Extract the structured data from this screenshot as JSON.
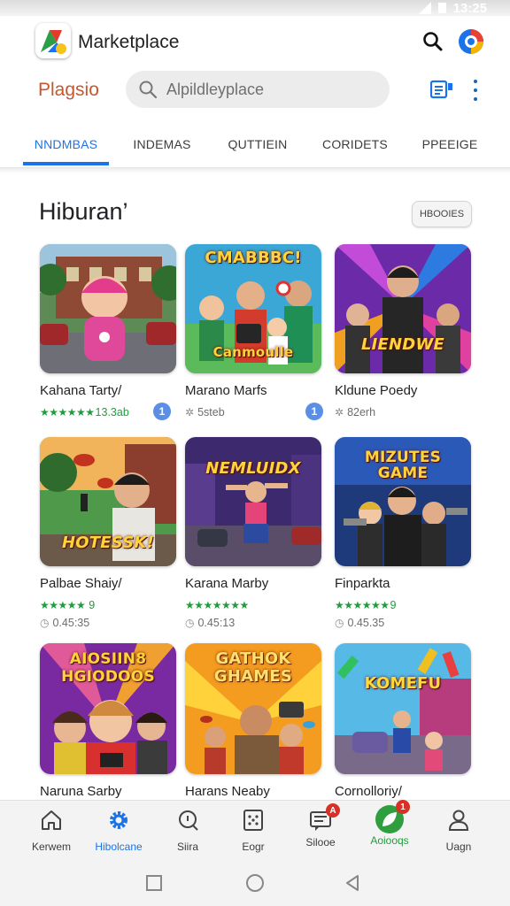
{
  "status_bar": {
    "time": "13:25"
  },
  "app_bar": {
    "title": "Marketplace",
    "icons": [
      "app-logo-icon",
      "search-icon",
      "account-icon"
    ]
  },
  "search": {
    "brand": "Plagsio",
    "placeholder": "Alpildleyplace"
  },
  "tabs": [
    {
      "label": "NNDMBAS",
      "active": true
    },
    {
      "label": "INDEMAS",
      "active": false
    },
    {
      "label": "QUTTIEIN",
      "active": false
    },
    {
      "label": "CORIDETS",
      "active": false
    },
    {
      "label": "PPEEIGE",
      "active": false
    }
  ],
  "section": {
    "title": "Hiburan’",
    "more_label": "HBOOIES"
  },
  "cards": [
    {
      "thumb_text": "",
      "name": "Kahana Tarty/",
      "stars": "★★★★★★",
      "rating": "13.3ab",
      "badge": "1",
      "size": ""
    },
    {
      "thumb_text": "CMABBBC!",
      "thumb_text2": "Canmoulle",
      "name": "Marano Marfs",
      "meta": "5steb",
      "badge": "1",
      "size": ""
    },
    {
      "thumb_text": "LIENDWE",
      "name": "Kldune Poedy",
      "meta": "82erh",
      "size": ""
    },
    {
      "thumb_text": "HOTESSK!",
      "name": "Palbae Shaiy/",
      "stars": "★★★★★",
      "rating": "9",
      "size": "0.45:35"
    },
    {
      "thumb_text": "NEMLUIDX",
      "name": "Karana Marby",
      "stars": "★★★★★★★",
      "rating": "",
      "size": "0.45:13"
    },
    {
      "thumb_text": "MIZUTES GAME",
      "name": "Finparkta",
      "stars": "★★★★★★",
      "rating": "9",
      "size": "0.45.35"
    },
    {
      "thumb_text": "AIOSIIN8 HGIODOOS",
      "name": "Naruna Sarby",
      "size": ""
    },
    {
      "thumb_text": "GATHOK GHAMES",
      "name": "Harans Neaby",
      "size": ""
    },
    {
      "thumb_text": "KOMEFU",
      "name": "Cornolloriy/",
      "size": ""
    }
  ],
  "bottom_nav": [
    {
      "label": "Kerwem",
      "icon": "home-icon"
    },
    {
      "label": "Hibolcane",
      "icon": "gear-icon",
      "active": true
    },
    {
      "label": "Siira",
      "icon": "info-icon"
    },
    {
      "label": "Eogr",
      "icon": "grid-icon"
    },
    {
      "label": "Silooe",
      "icon": "message-icon",
      "badge": "A"
    },
    {
      "label": "Aoiooqs",
      "icon": "leaf-icon",
      "badge": "1"
    },
    {
      "label": "Uagn",
      "icon": "person-icon"
    }
  ],
  "system_nav": [
    "recents-button",
    "home-button",
    "back-button"
  ],
  "colors": {
    "accent": "#1a73e8",
    "rating_green": "#1e9e3b",
    "brand_orange": "#c8572c"
  }
}
